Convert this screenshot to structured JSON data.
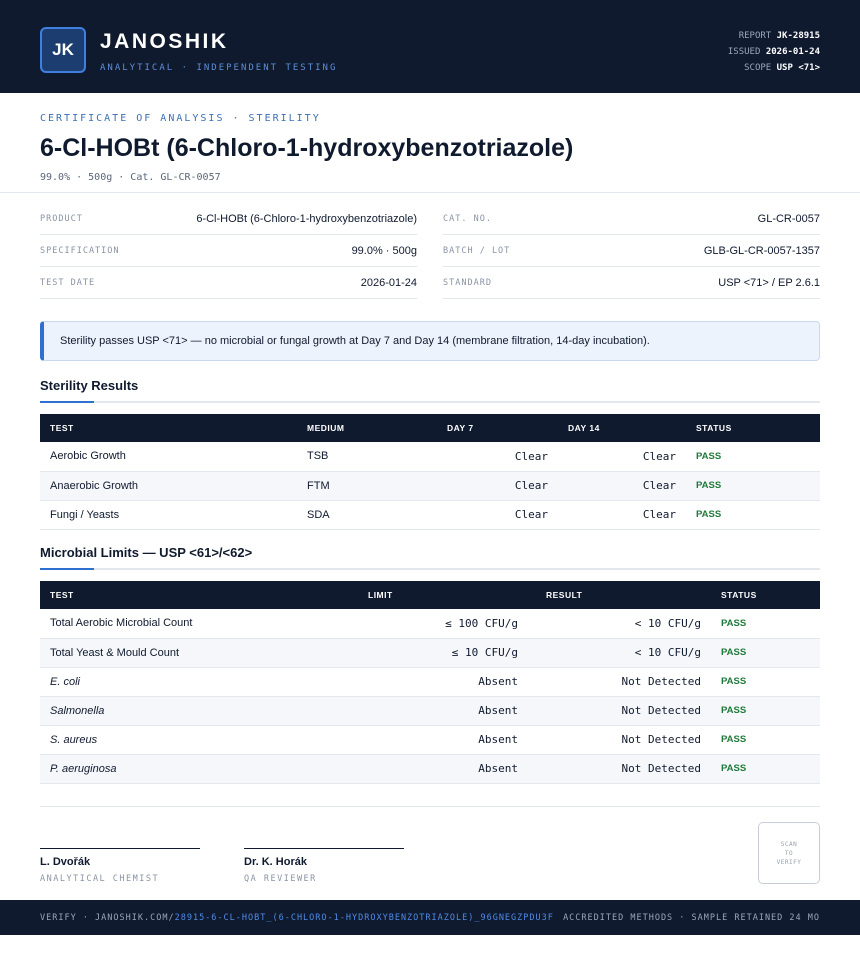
{
  "header": {
    "logo": "JK",
    "brand": "JANOSHIK",
    "tagline": "ANALYTICAL · INDEPENDENT TESTING",
    "report_label": "REPORT",
    "report_value": "JK-28915",
    "issued_label": "ISSUED",
    "issued_value": "2026-01-24",
    "scope_label": "SCOPE",
    "scope_value": "USP <71>"
  },
  "title_block": {
    "kicker": "CERTIFICATE OF ANALYSIS · STERILITY",
    "title": "6-Cl-HOBt (6-Chloro-1-hydroxybenzotriazole)",
    "subline": "99.0% · 500g  ·  Cat. GL-CR-0057"
  },
  "info_left": [
    {
      "label": "PRODUCT",
      "value": "6-Cl-HOBt (6-Chloro-1-hydroxybenzotriazole)"
    },
    {
      "label": "SPECIFICATION",
      "value": "99.0% · 500g"
    },
    {
      "label": "TEST DATE",
      "value": "2026-01-24"
    }
  ],
  "info_right": [
    {
      "label": "CAT. NO.",
      "value": "GL-CR-0057"
    },
    {
      "label": "BATCH / LOT",
      "value": "GLB-GL-CR-0057-1357"
    },
    {
      "label": "STANDARD",
      "value": "USP <71> / EP 2.6.1"
    }
  ],
  "callout": "Sterility passes USP <71> — no microbial or fungal growth at Day 7 and Day 14 (membrane filtration, 14-day incubation).",
  "sterility": {
    "title": "Sterility Results",
    "headers": [
      "TEST",
      "MEDIUM",
      "DAY 7",
      "DAY 14",
      "STATUS"
    ],
    "rows": [
      {
        "test": "Aerobic Growth",
        "medium": "TSB",
        "day7": "Clear",
        "day14": "Clear",
        "status": "PASS"
      },
      {
        "test": "Anaerobic Growth",
        "medium": "FTM",
        "day7": "Clear",
        "day14": "Clear",
        "status": "PASS"
      },
      {
        "test": "Fungi / Yeasts",
        "medium": "SDA",
        "day7": "Clear",
        "day14": "Clear",
        "status": "PASS"
      }
    ]
  },
  "microbial": {
    "title": "Microbial Limits — USP <61>/<62>",
    "headers": [
      "TEST",
      "LIMIT",
      "RESULT",
      "STATUS"
    ],
    "rows": [
      {
        "test": "Total Aerobic Microbial Count",
        "limit": "≤ 100 CFU/g",
        "result": "< 10 CFU/g",
        "status": "PASS"
      },
      {
        "test": "Total Yeast & Mould Count",
        "limit": "≤ 10 CFU/g",
        "result": "< 10 CFU/g",
        "status": "PASS"
      },
      {
        "test": "E. coli",
        "limit": "Absent",
        "result": "Not Detected",
        "status": "PASS"
      },
      {
        "test": "Salmonella",
        "limit": "Absent",
        "result": "Not Detected",
        "status": "PASS"
      },
      {
        "test": "S. aureus",
        "limit": "Absent",
        "result": "Not Detected",
        "status": "PASS"
      },
      {
        "test": "P. aeruginosa",
        "limit": "Absent",
        "result": "Not Detected",
        "status": "PASS"
      }
    ]
  },
  "signatures": [
    {
      "name": "L. Dvořák",
      "role": "ANALYTICAL CHEMIST"
    },
    {
      "name": "Dr. K. Horák",
      "role": "QA REVIEWER"
    }
  ],
  "qr_label": [
    "SCAN",
    "TO",
    "VERIFY"
  ],
  "footer": {
    "verify_prefix": "VERIFY · JANOSHIK.COM/",
    "verify_path": "28915-6-CL-HOBT_(6-CHLORO-1-HYDROXYBENZOTRIAZOLE)_96GNEGZPDU3F",
    "right": "ACCREDITED METHODS · SAMPLE RETAINED 24 MO"
  },
  "colors": {
    "navy": "#0f1a2e",
    "accent": "#2f6fd0",
    "pass": "#1f7a3a"
  }
}
